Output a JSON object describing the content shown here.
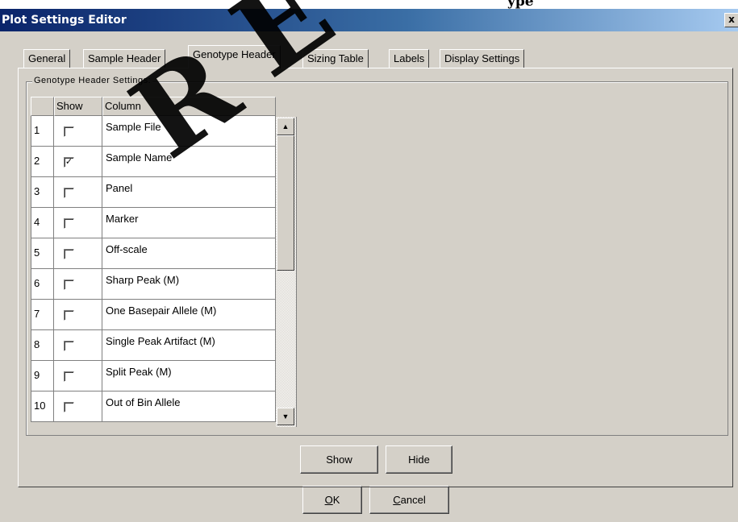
{
  "window": {
    "title": "Plot Settings Editor",
    "close_glyph": "x",
    "behind_window_text": "ype"
  },
  "tabs": [
    {
      "label": "General",
      "active": false
    },
    {
      "label": "Sample Header",
      "active": false
    },
    {
      "label": "Genotype Header",
      "active": true
    },
    {
      "label": "Sizing Table",
      "active": false
    },
    {
      "label": "Labels",
      "active": false
    },
    {
      "label": "Display Settings",
      "active": false
    }
  ],
  "group": {
    "legend": "Genotype Header Settings:"
  },
  "table": {
    "headers": {
      "num": "",
      "show": "Show",
      "column": "Column"
    },
    "rows": [
      {
        "num": "1",
        "checked": false,
        "check_glyph": "",
        "column": "Sample File"
      },
      {
        "num": "2",
        "checked": true,
        "check_glyph": "✓",
        "column": "Sample Name"
      },
      {
        "num": "3",
        "checked": false,
        "check_glyph": "",
        "column": "Panel"
      },
      {
        "num": "4",
        "checked": false,
        "check_glyph": "",
        "column": "Marker"
      },
      {
        "num": "5",
        "checked": false,
        "check_glyph": "",
        "column": "Off-scale"
      },
      {
        "num": "6",
        "checked": false,
        "check_glyph": "",
        "column": "Sharp Peak (M)"
      },
      {
        "num": "7",
        "checked": false,
        "check_glyph": "",
        "column": "One Basepair Allele (M)"
      },
      {
        "num": "8",
        "checked": false,
        "check_glyph": "",
        "column": "Single Peak Artifact (M)"
      },
      {
        "num": "9",
        "checked": false,
        "check_glyph": "",
        "column": "Split Peak (M)"
      },
      {
        "num": "10",
        "checked": false,
        "check_glyph": "",
        "column": "Out of Bin Allele"
      }
    ],
    "scroll_up_glyph": "▲",
    "scroll_down_glyph": "▼"
  },
  "buttons": {
    "show": "Show",
    "hide": "Hide",
    "ok_underline": "O",
    "ok_rest": "K",
    "cancel_underline": "C",
    "cancel_rest": "ancel"
  },
  "watermark": {
    "letter_r": "R",
    "letter_e": "E"
  },
  "colors": {
    "dialog_bg": "#d4d0c8",
    "title_start": "#0a246a",
    "title_end": "#a6caf0"
  }
}
